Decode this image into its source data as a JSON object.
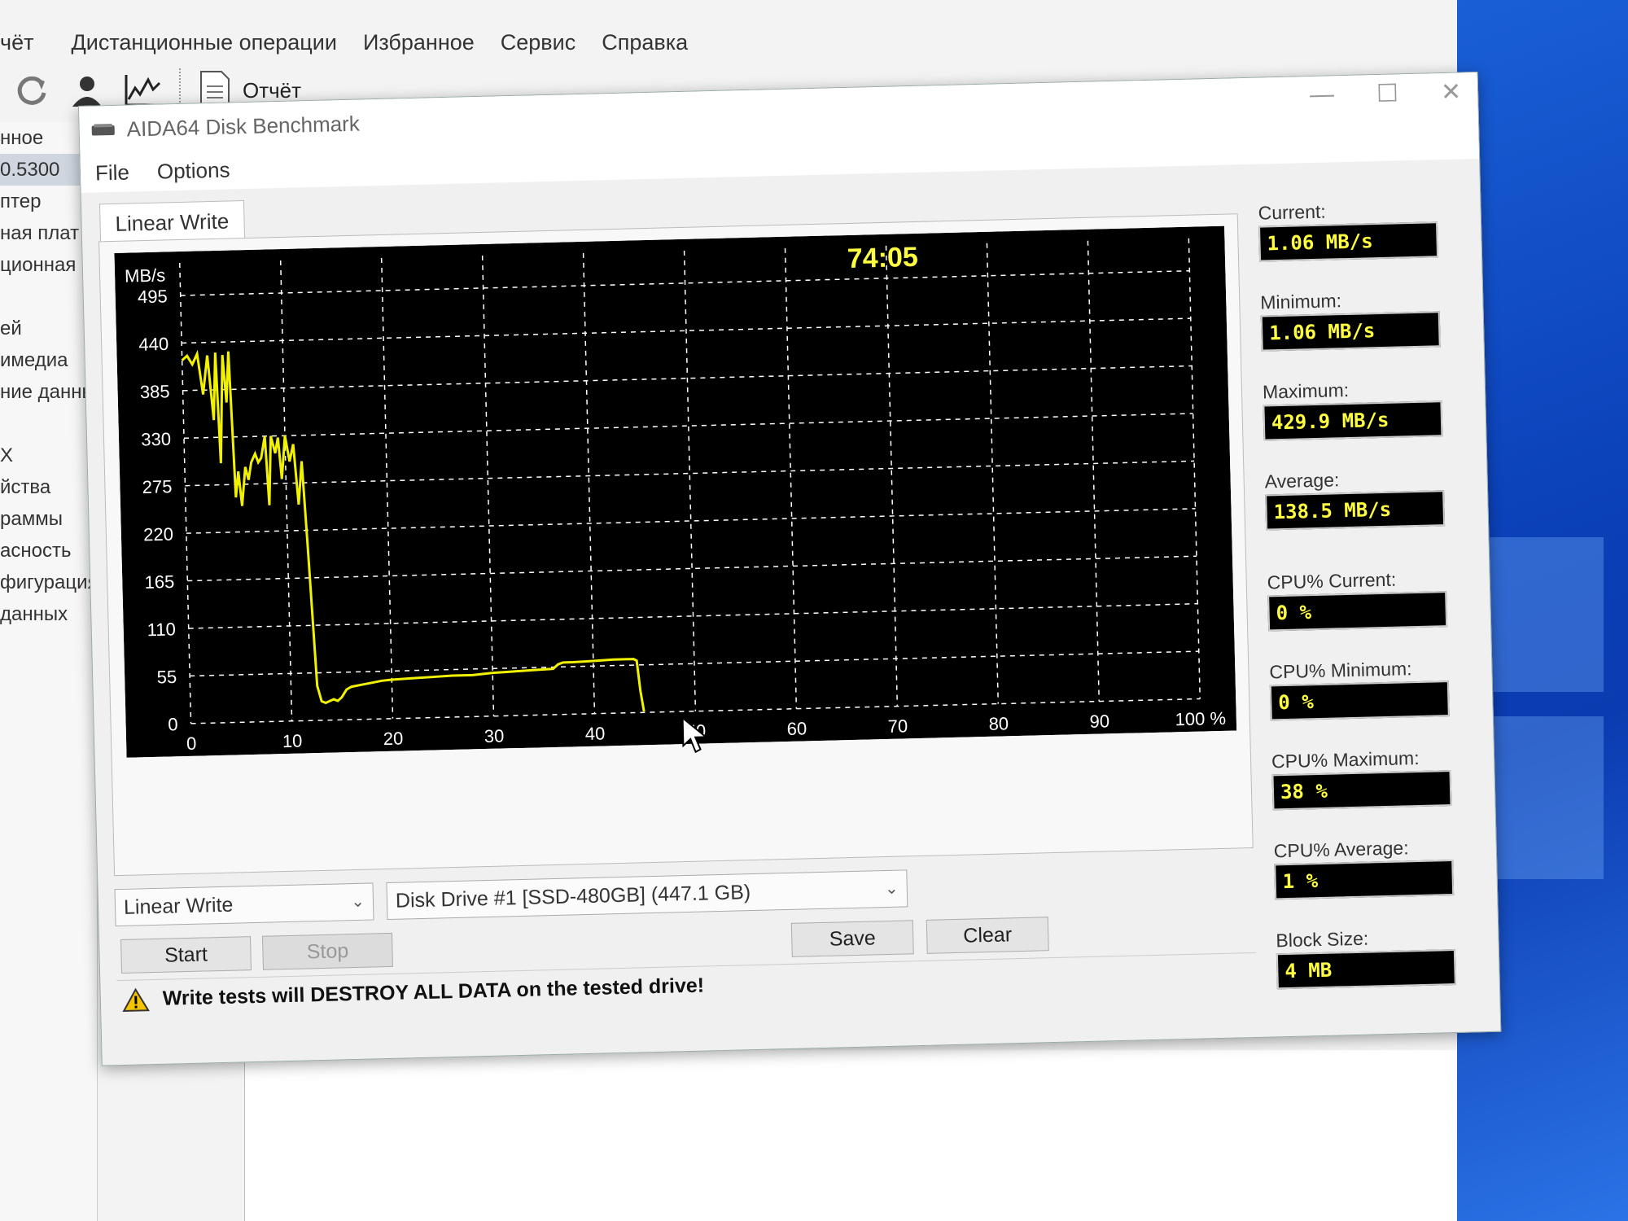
{
  "main_menu": [
    "чёт",
    "Дистанционные операции",
    "Избранное",
    "Сервис",
    "Справка"
  ],
  "toolbar": {
    "report_label": "Отчёт"
  },
  "sidebar": [
    "нное",
    "0.5300",
    "птер",
    "ная плат",
    "ционная с",
    "",
    "ей",
    "имедиа",
    "ние данны",
    "",
    "X",
    "йства",
    "раммы",
    "асность",
    "фигурация",
    "данных"
  ],
  "dialog": {
    "title": "AIDA64 Disk Benchmark",
    "menu": [
      "File",
      "Options"
    ],
    "tab": "Linear Write",
    "timer": "74:05"
  },
  "stats": [
    {
      "label": "Current:",
      "value": "1.06 MB/s"
    },
    {
      "label": "Minimum:",
      "value": "1.06 MB/s"
    },
    {
      "label": "Maximum:",
      "value": "429.9 MB/s"
    },
    {
      "label": "Average:",
      "value": "138.5 MB/s"
    },
    {
      "label": "CPU% Current:",
      "value": "0 %"
    },
    {
      "label": "CPU% Minimum:",
      "value": "0 %"
    },
    {
      "label": "CPU% Maximum:",
      "value": "38 %"
    },
    {
      "label": "CPU% Average:",
      "value": "1 %"
    },
    {
      "label": "Block Size:",
      "value": "4 MB"
    }
  ],
  "controls": {
    "test_select": "Linear Write",
    "drive_select": "Disk Drive #1  [SSD-480GB]  (447.1 GB)",
    "start": "Start",
    "stop": "Stop",
    "save": "Save",
    "clear": "Clear",
    "warning": "Write tests will DESTROY ALL DATA on the tested drive!"
  },
  "chart_data": {
    "type": "line",
    "ylabel": "MB/s",
    "xlabel": "",
    "x_unit_label": "100 %",
    "ylim": [
      0,
      495
    ],
    "xlim": [
      0,
      100
    ],
    "yticks": [
      0,
      55,
      110,
      165,
      220,
      275,
      330,
      385,
      440,
      495
    ],
    "xticks": [
      0,
      10,
      20,
      30,
      40,
      50,
      60,
      70,
      80,
      90,
      100
    ],
    "grid": true,
    "colors": {
      "background": "#000000",
      "line": "#f2f200",
      "grid": "#ffffff",
      "text": "#ffffff",
      "timer": "#ffff40"
    },
    "series": [
      {
        "x": [
          0,
          0.5,
          1,
          1.5,
          2,
          2.5,
          3,
          3.3,
          3.6,
          4,
          4.3,
          4.6,
          5,
          5.3,
          5.6,
          6,
          6.3,
          6.6,
          7,
          7.3,
          7.6,
          8,
          8.3,
          8.6,
          9,
          9.3,
          9.6,
          10,
          10.4,
          10.8,
          11.2,
          11.6,
          12,
          12.3,
          12.6,
          13,
          13.4,
          13.8,
          14.2,
          14.6,
          15,
          15.5,
          16,
          17,
          18,
          19,
          20,
          22,
          24,
          26,
          28,
          30,
          32,
          34,
          36,
          36.5,
          37,
          38,
          40,
          42,
          44,
          44.3,
          44.6,
          44.9
        ],
        "y": [
          420,
          425,
          415,
          427,
          380,
          425,
          350,
          428,
          300,
          425,
          370,
          429,
          260,
          290,
          250,
          295,
          280,
          300,
          310,
          300,
          305,
          330,
          250,
          330,
          310,
          328,
          280,
          330,
          300,
          320,
          250,
          300,
          200,
          120,
          40,
          22,
          20,
          22,
          24,
          22,
          26,
          35,
          38,
          40,
          42,
          44,
          45,
          46,
          47,
          48,
          48,
          50,
          51,
          52,
          53,
          58,
          60,
          60,
          61,
          62,
          62,
          60,
          25,
          1
        ]
      }
    ]
  }
}
